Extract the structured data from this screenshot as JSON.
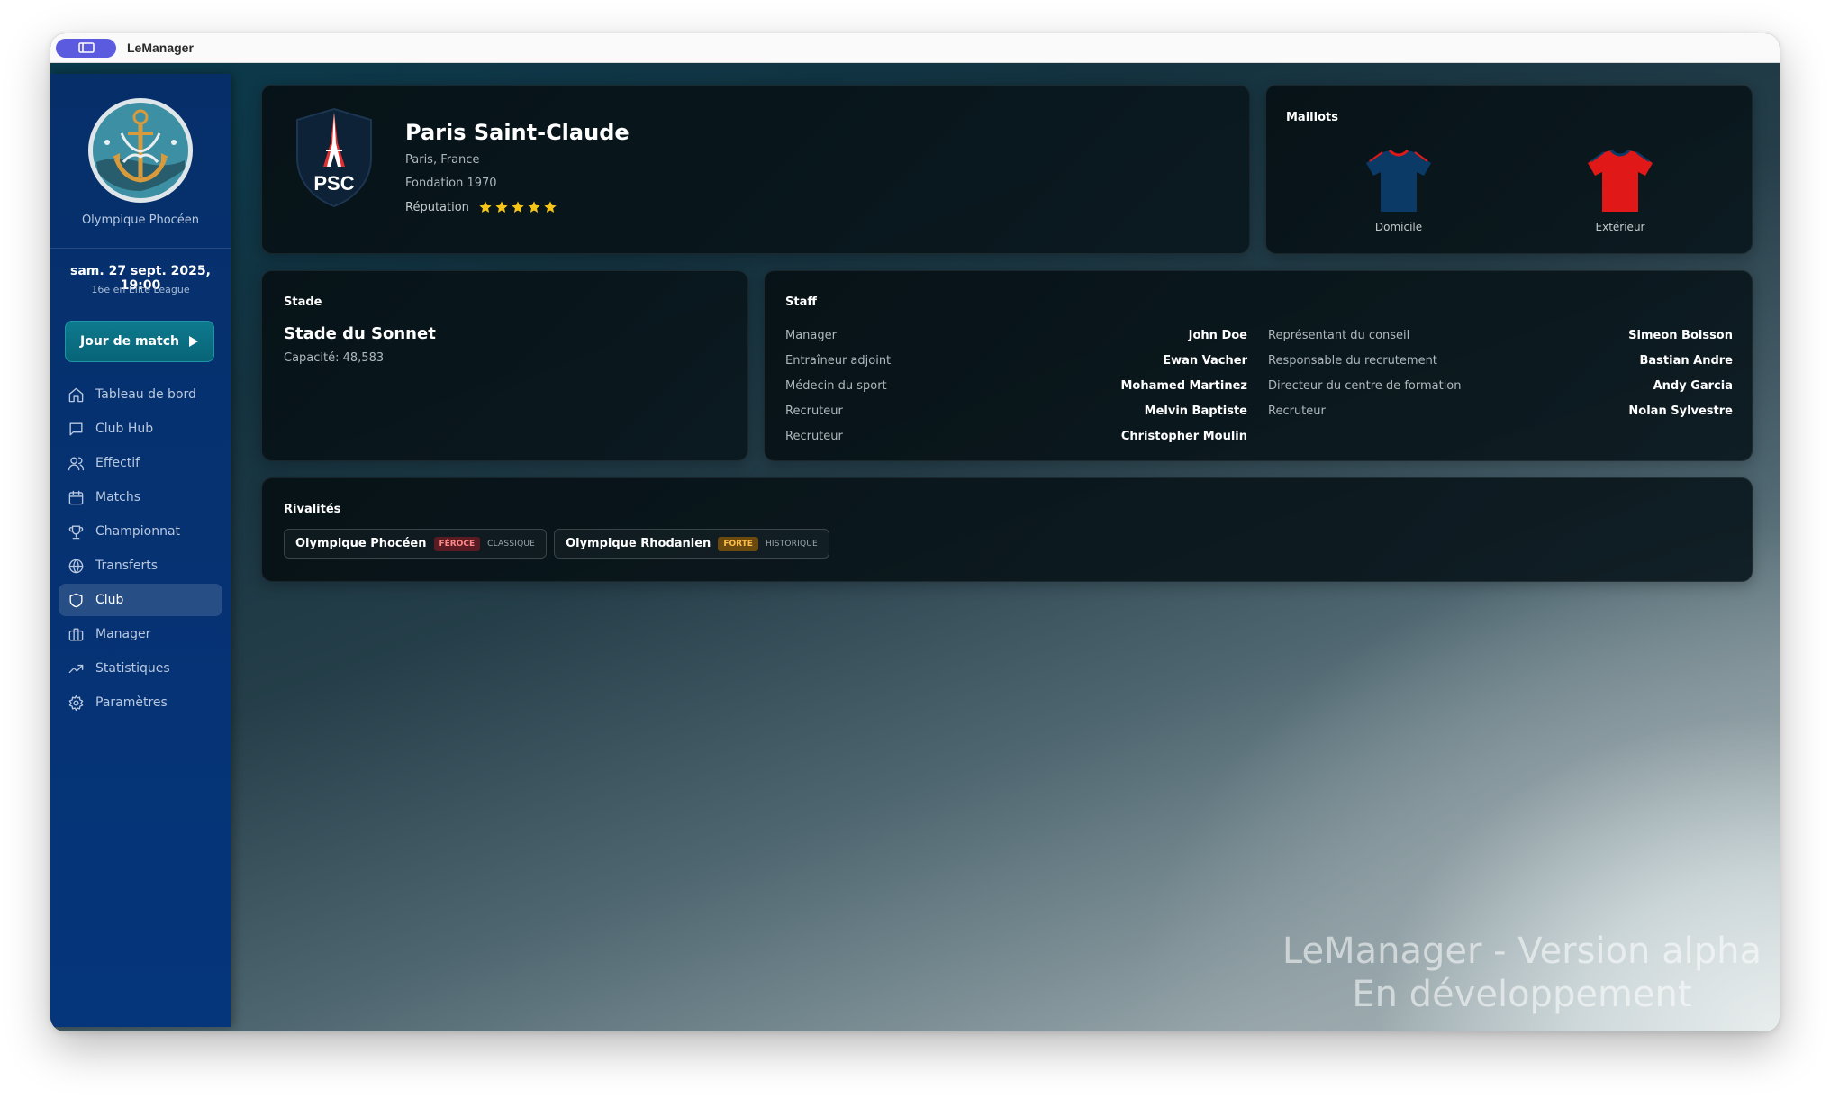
{
  "window": {
    "title": "LeManager"
  },
  "sidebar": {
    "club_name": "Olympique Phocéen",
    "date": "sam. 27 sept. 2025, 19:00",
    "league_position": "16e en Elite League",
    "match_button": "Jour de match",
    "nav": [
      {
        "label": "Tableau de bord",
        "icon": "home-icon"
      },
      {
        "label": "Club Hub",
        "icon": "chat-icon"
      },
      {
        "label": "Effectif",
        "icon": "users-icon"
      },
      {
        "label": "Matchs",
        "icon": "calendar-icon"
      },
      {
        "label": "Championnat",
        "icon": "trophy-icon"
      },
      {
        "label": "Transferts",
        "icon": "globe-icon"
      },
      {
        "label": "Club",
        "icon": "shield-icon",
        "active": true
      },
      {
        "label": "Manager",
        "icon": "briefcase-icon"
      },
      {
        "label": "Statistiques",
        "icon": "trending-up-icon"
      },
      {
        "label": "Paramètres",
        "icon": "gear-icon"
      }
    ]
  },
  "club": {
    "crest_text": "PSC",
    "name": "Paris Saint-Claude",
    "location": "Paris, France",
    "founded": "Fondation 1970",
    "reputation_label": "Réputation",
    "reputation_stars": 5
  },
  "kits": {
    "title": "Maillots",
    "home": {
      "label": "Domicile",
      "color": "#0b3a66"
    },
    "away": {
      "label": "Extérieur",
      "color": "#e01818"
    }
  },
  "stadium": {
    "title": "Stade",
    "name": "Stade du Sonnet",
    "capacity": "Capacité: 48,583"
  },
  "staff": {
    "title": "Staff",
    "left": [
      {
        "role": "Manager",
        "name": "John Doe"
      },
      {
        "role": "Entraîneur adjoint",
        "name": "Ewan Vacher"
      },
      {
        "role": "Médecin du sport",
        "name": "Mohamed Martinez"
      },
      {
        "role": "Recruteur",
        "name": "Melvin Baptiste"
      },
      {
        "role": "Recruteur",
        "name": "Christopher Moulin"
      }
    ],
    "right": [
      {
        "role": "Représentant du conseil",
        "name": "Simeon Boisson"
      },
      {
        "role": "Responsable du recrutement",
        "name": "Bastian Andre"
      },
      {
        "role": "Directeur du centre de formation",
        "name": "Andy Garcia"
      },
      {
        "role": "Recruteur",
        "name": "Nolan Sylvestre"
      }
    ]
  },
  "rivalries": {
    "title": "Rivalités",
    "items": [
      {
        "club": "Olympique Phocéen",
        "intensity": "FÉROCE",
        "type": "CLASSIQUE"
      },
      {
        "club": "Olympique Rhodanien",
        "intensity": "FORTE",
        "type": "HISTORIQUE"
      }
    ]
  },
  "watermark": {
    "line1": "LeManager - Version alpha",
    "line2": "En développement"
  }
}
